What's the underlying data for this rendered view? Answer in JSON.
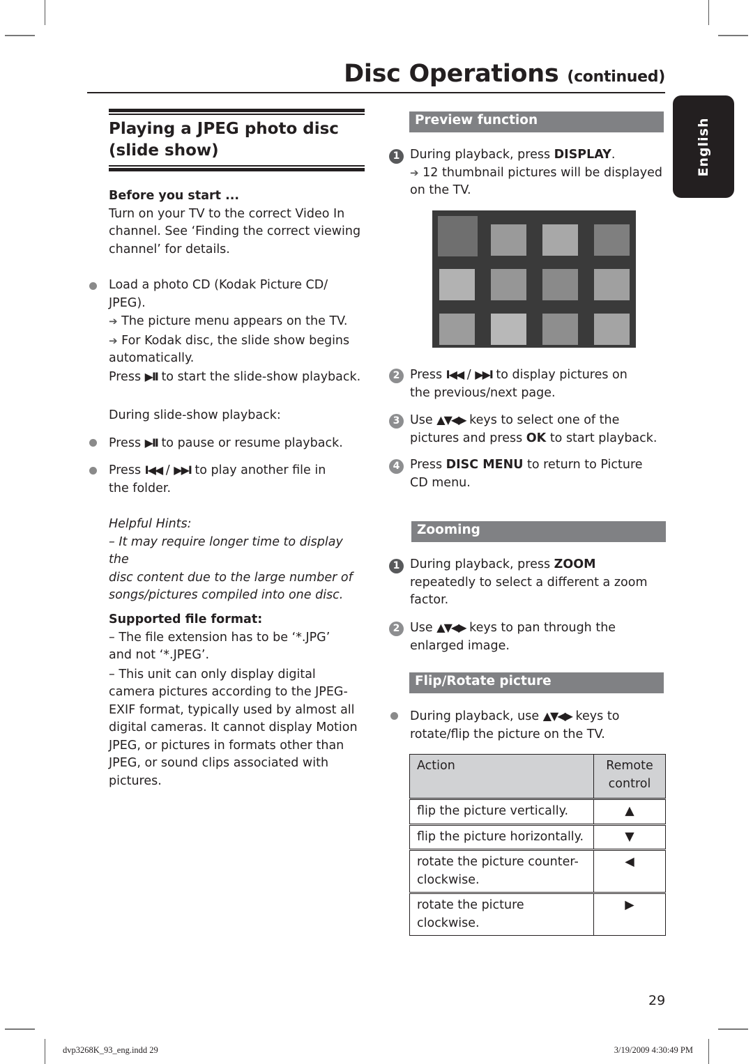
{
  "header": {
    "title": "Disc Operations",
    "title_suffix": "(continued)",
    "language_tab": "English"
  },
  "left": {
    "section_title_line1": "Playing a JPEG photo disc",
    "section_title_line2": "(slide show)",
    "before_start_heading": "Before you start ...",
    "before_start_lines": [
      "Turn on your TV to the correct Video In",
      "channel. See ‘Finding the correct viewing",
      "channel’ for details."
    ],
    "load_bullet": {
      "lines": [
        "Load a photo CD (Kodak Picture CD/",
        "JPEG)."
      ],
      "result1": "The picture menu appears on the TV.",
      "result2_line1": "For Kodak disc, the slide show begins",
      "result2_line2": "automatically.",
      "press_prefix": "Press",
      "press_glyph": "▶II",
      "press_suffix": "to start the slide-show playback."
    },
    "during_label": "During slide-show playback:",
    "pause_bullet": {
      "prefix": "Press",
      "glyph": "▶II",
      "suffix": "to pause or resume playback."
    },
    "skip_bullet": {
      "prefix": "Press",
      "glyph_prev": "I◀◀",
      "sep": "/",
      "glyph_next": "▶▶I",
      "suffix": "to play another file in",
      "line2": "the folder."
    },
    "hints_heading": "Helpful Hints:",
    "hints_lines": [
      "–  It may require longer time to display the",
      "disc content due to the large number of",
      "songs/pictures compiled into one disc."
    ],
    "formats_heading": "Supported file format:",
    "formats_lines_1": [
      "–   The file extension has to be ‘*.JPG’",
      "and not ‘*.JPEG’."
    ],
    "formats_lines_2": [
      "–  This unit can only display digital",
      "camera pictures according to the JPEG-",
      "EXIF format, typically used by almost all",
      "digital cameras. It cannot display Motion",
      "JPEG, or pictures in formats other than",
      "JPEG, or sound clips associated with",
      "pictures."
    ]
  },
  "right": {
    "preview": {
      "heading": "Preview function",
      "step1": {
        "num": "1",
        "prefix": "During playback, press",
        "key": "DISPLAY",
        "suffix": ".",
        "result_line1": "12 thumbnail pictures will be displayed",
        "result_line2": "on the TV."
      },
      "thumbnail_count": 12,
      "step2": {
        "num": "2",
        "prefix": "Press",
        "glyph_prev": "I◀◀",
        "sep": "/",
        "glyph_next": "▶▶I",
        "suffix": "to display pictures on",
        "line2": "the previous/next page."
      },
      "step3": {
        "num": "3",
        "prefix": "Use",
        "glyph": "▲▼◀▶",
        "suffix": "keys to select one of the",
        "line2_prefix": "pictures and press",
        "key": "OK",
        "line2_suffix": "to start playback."
      },
      "step4": {
        "num": "4",
        "prefix": "Press",
        "key": "DISC MENU",
        "suffix": "to return to Picture",
        "line2": "CD menu."
      }
    },
    "zooming": {
      "heading": "Zooming",
      "step1": {
        "num": "1",
        "prefix": "During playback, press",
        "key": "ZOOM",
        "line2": "repeatedly to select a different a zoom",
        "line3": "factor."
      },
      "step2": {
        "num": "2",
        "prefix": "Use",
        "glyph": "▲▼◀▶",
        "suffix": "keys to pan through the",
        "line2": "enlarged image."
      }
    },
    "flip": {
      "heading": "Flip/Rotate picture",
      "bullet_prefix": "During playback, use",
      "bullet_glyph": "▲▼◀▶",
      "bullet_suffix": "keys to",
      "bullet_line2": "rotate/flip the picture on the TV.",
      "table": {
        "headers": [
          "Action",
          "Remote control"
        ],
        "rows": [
          [
            "flip the picture vertically.",
            "▲"
          ],
          [
            "flip the picture horizontally.",
            "▼"
          ],
          [
            "rotate the picture counter-clockwise.",
            "◀"
          ],
          [
            "rotate the picture clockwise.",
            "▶"
          ]
        ]
      }
    }
  },
  "footer": {
    "page_number": "29",
    "slug_file": "dvp3268K_93_eng.indd   29",
    "slug_date": "3/19/2009   4:30:49 PM"
  }
}
